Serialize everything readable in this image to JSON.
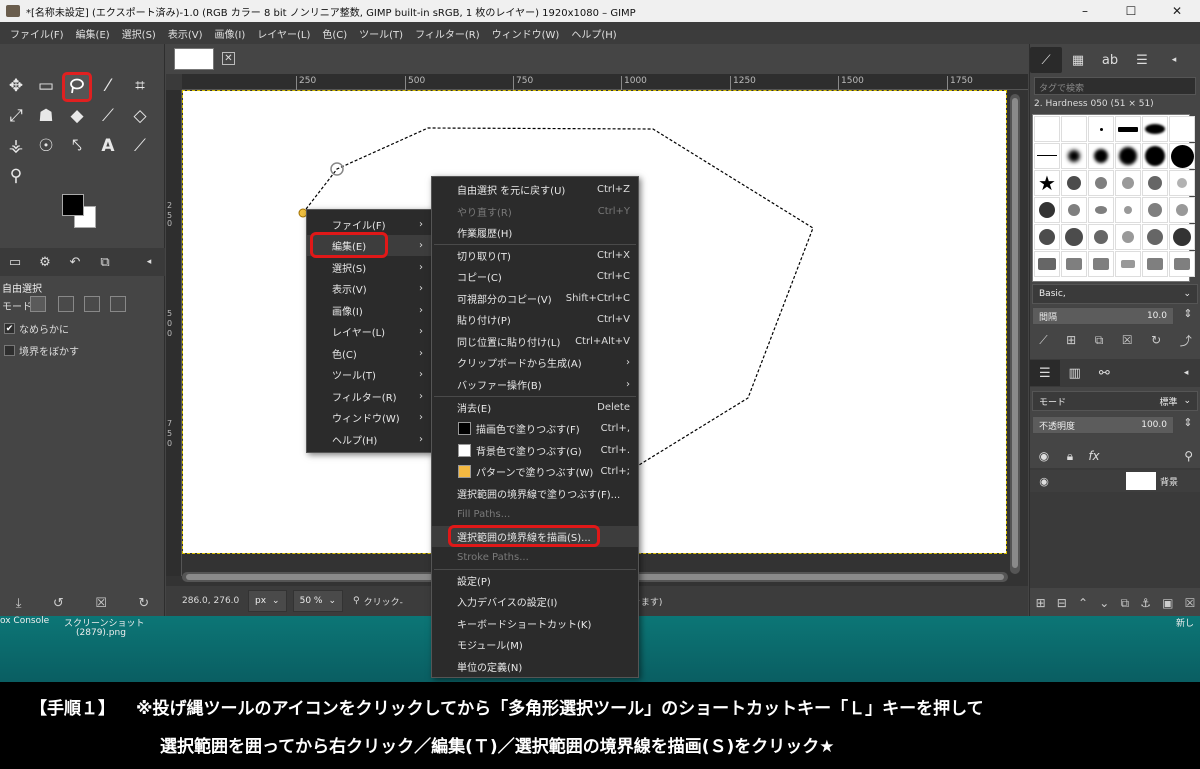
{
  "window": {
    "title": "*[名称未設定] (エクスポート済み)-1.0 (RGB カラー 8 bit ノンリニア整数, GIMP built-in sRGB, 1 枚のレイヤー) 1920x1080 – GIMP",
    "minimize": "–",
    "maximize": "☐",
    "close": "✕"
  },
  "menubar": [
    "ファイル(F)",
    "編集(E)",
    "選択(S)",
    "表示(V)",
    "画像(I)",
    "レイヤー(L)",
    "色(C)",
    "ツール(T)",
    "フィルター(R)",
    "ウィンドウ(W)",
    "ヘルプ(H)"
  ],
  "toolbox": {
    "highlighted_tool": "free-select-tool",
    "tool_options": {
      "title": "自由選択",
      "mode_label": "モード:",
      "antialias_label": "なめらかに",
      "antialias_checked": "✔",
      "feather_label": "境界をぼかす"
    }
  },
  "canvas": {
    "ruler_ticks": [
      "250",
      "500",
      "750",
      "1000",
      "1250",
      "1500",
      "1750"
    ],
    "vertical_ticks": [
      "2",
      "5",
      "0",
      "5",
      "0",
      "0",
      "7",
      "5",
      "0"
    ],
    "status": {
      "coords": "286.0, 276.0",
      "unit": "px",
      "zoom": "50 %",
      "message_start": "クリック-",
      "message_end": "できます)"
    }
  },
  "dock": {
    "tag_placeholder": "タグで検索",
    "brush_name": "2. Hardness 050 (51 × 51)",
    "preset": "Basic,",
    "spacing_label": "間隔",
    "spacing_value": "10.0",
    "layer_mode_label": "モード",
    "layer_mode_value": "標準",
    "opacity_label": "不透明度",
    "opacity_value": "100.0",
    "layer_name": "背景"
  },
  "desktop": {
    "label1": "ox Console",
    "label2": "スクリーンショット",
    "label3": "(2879).png",
    "label4": "新し"
  },
  "main_menu": {
    "items": [
      {
        "label": "ファイル(F)"
      },
      {
        "label": "編集(E)"
      },
      {
        "label": "選択(S)"
      },
      {
        "label": "表示(V)"
      },
      {
        "label": "画像(I)"
      },
      {
        "label": "レイヤー(L)"
      },
      {
        "label": "色(C)"
      },
      {
        "label": "ツール(T)"
      },
      {
        "label": "フィルター(R)"
      },
      {
        "label": "ウィンドウ(W)"
      },
      {
        "label": "ヘルプ(H)"
      }
    ]
  },
  "edit_menu": {
    "items": [
      {
        "label": "自由選択 を元に戻す(U)",
        "shortcut": "Ctrl+Z"
      },
      {
        "label": "やり直す(R)",
        "shortcut": "Ctrl+Y"
      },
      {
        "label": "作業履歴(H)",
        "shortcut": ""
      },
      {
        "label": "切り取り(T)",
        "shortcut": "Ctrl+X"
      },
      {
        "label": "コピー(C)",
        "shortcut": "Ctrl+C"
      },
      {
        "label": "可視部分のコピー(V)",
        "shortcut": "Shift+Ctrl+C"
      },
      {
        "label": "貼り付け(P)",
        "shortcut": "Ctrl+V"
      },
      {
        "label": "同じ位置に貼り付け(L)",
        "shortcut": "Ctrl+Alt+V"
      },
      {
        "label": "クリップボードから生成(A)",
        "shortcut": ""
      },
      {
        "label": "バッファー操作(B)",
        "shortcut": ""
      },
      {
        "label": "消去(E)",
        "shortcut": "Delete"
      },
      {
        "label": "描画色で塗りつぶす(F)",
        "shortcut": "Ctrl+,"
      },
      {
        "label": "背景色で塗りつぶす(G)",
        "shortcut": "Ctrl+."
      },
      {
        "label": "パターンで塗りつぶす(W)",
        "shortcut": "Ctrl+;"
      },
      {
        "label": "選択範囲の境界線で塗りつぶす(F)...",
        "shortcut": ""
      },
      {
        "label": "Fill Paths...",
        "shortcut": ""
      },
      {
        "label": "選択範囲の境界線を描画(S)...",
        "shortcut": ""
      },
      {
        "label": "Stroke Paths...",
        "shortcut": ""
      },
      {
        "label": "設定(P)",
        "shortcut": ""
      },
      {
        "label": "入力デバイスの設定(I)",
        "shortcut": ""
      },
      {
        "label": "キーボードショートカット(K)",
        "shortcut": ""
      },
      {
        "label": "モジュール(M)",
        "shortcut": ""
      },
      {
        "label": "単位の定義(N)",
        "shortcut": ""
      }
    ]
  },
  "caption": {
    "step": "【手順１】",
    "line1": "※投げ縄ツールのアイコンをクリックしてから「多角形選択ツール」のショートカットキー「Ｌ」キーを押して",
    "line2": "選択範囲を囲ってから右クリック／編集(Ｔ)／選択範囲の境界線を描画(Ｓ)をクリック★"
  },
  "colors": {
    "highlight_red": "#e01818",
    "fill_fg": "#000000",
    "fill_bg": "#ffffff",
    "fill_pattern": "#f4b942",
    "desktop_teal": "#0c7676"
  }
}
